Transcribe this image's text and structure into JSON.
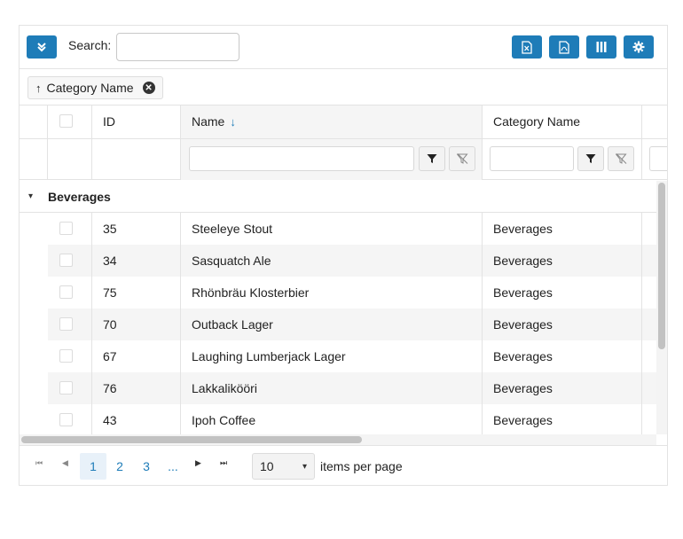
{
  "toolbar": {
    "search_label": "Search:",
    "search_value": "",
    "buttons": [
      "expand-toggle",
      "export-excel",
      "export-pdf",
      "column-chooser",
      "settings"
    ]
  },
  "group_panel": {
    "chip_arrow": "↑",
    "chip_label": "Category Name"
  },
  "columns": {
    "id": "ID",
    "name": "Name",
    "name_sort": "↓",
    "category": "Category Name"
  },
  "group": {
    "toggle": "▾",
    "title": "Beverages"
  },
  "rows": [
    {
      "id": "35",
      "name": "Steeleye Stout",
      "category": "Beverages"
    },
    {
      "id": "34",
      "name": "Sasquatch Ale",
      "category": "Beverages"
    },
    {
      "id": "75",
      "name": "Rhönbräu Klosterbier",
      "category": "Beverages"
    },
    {
      "id": "70",
      "name": "Outback Lager",
      "category": "Beverages"
    },
    {
      "id": "67",
      "name": "Laughing Lumberjack Lager",
      "category": "Beverages"
    },
    {
      "id": "76",
      "name": "Lakkalikööri",
      "category": "Beverages"
    },
    {
      "id": "43",
      "name": "Ipoh Coffee",
      "category": "Beverages"
    }
  ],
  "pager": {
    "first": "⏮",
    "prev": "◀",
    "next": "▶",
    "last": "⏭",
    "pages": [
      "1",
      "2",
      "3",
      "..."
    ],
    "active_page": "1",
    "page_size": "10",
    "page_size_caret": "▾",
    "items_label": "items per page"
  },
  "colors": {
    "accent": "#1e7cb8",
    "border": "#e3e3e3",
    "alt_row": "#f5f5f5"
  }
}
